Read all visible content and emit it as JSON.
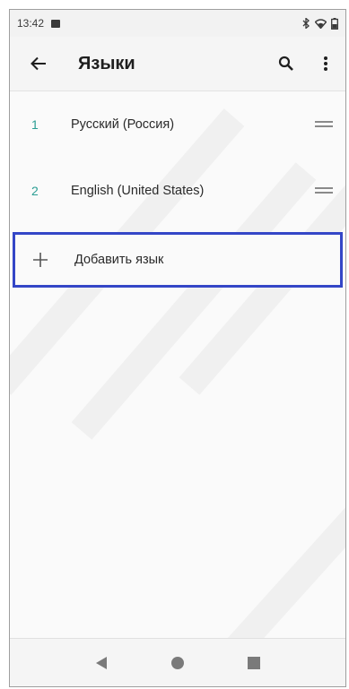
{
  "status_bar": {
    "time": "13:42",
    "icons": [
      "notification-icon",
      "bluetooth-icon",
      "wifi-icon",
      "battery-icon"
    ]
  },
  "toolbar": {
    "title": "Языки",
    "back_icon": "arrow-left-icon",
    "search_icon": "search-icon",
    "more_icon": "more-vert-icon"
  },
  "languages": [
    {
      "number": "1",
      "name": "Русский (Россия)"
    },
    {
      "number": "2",
      "name": "English (United States)"
    }
  ],
  "add_language": {
    "label": "Добавить язык",
    "icon": "plus-icon"
  },
  "nav_bar": {
    "icons": [
      "back-triangle-icon",
      "home-circle-icon",
      "recents-square-icon"
    ]
  },
  "colors": {
    "accent_number": "#2a9d93",
    "highlight_border": "#3446c7"
  }
}
